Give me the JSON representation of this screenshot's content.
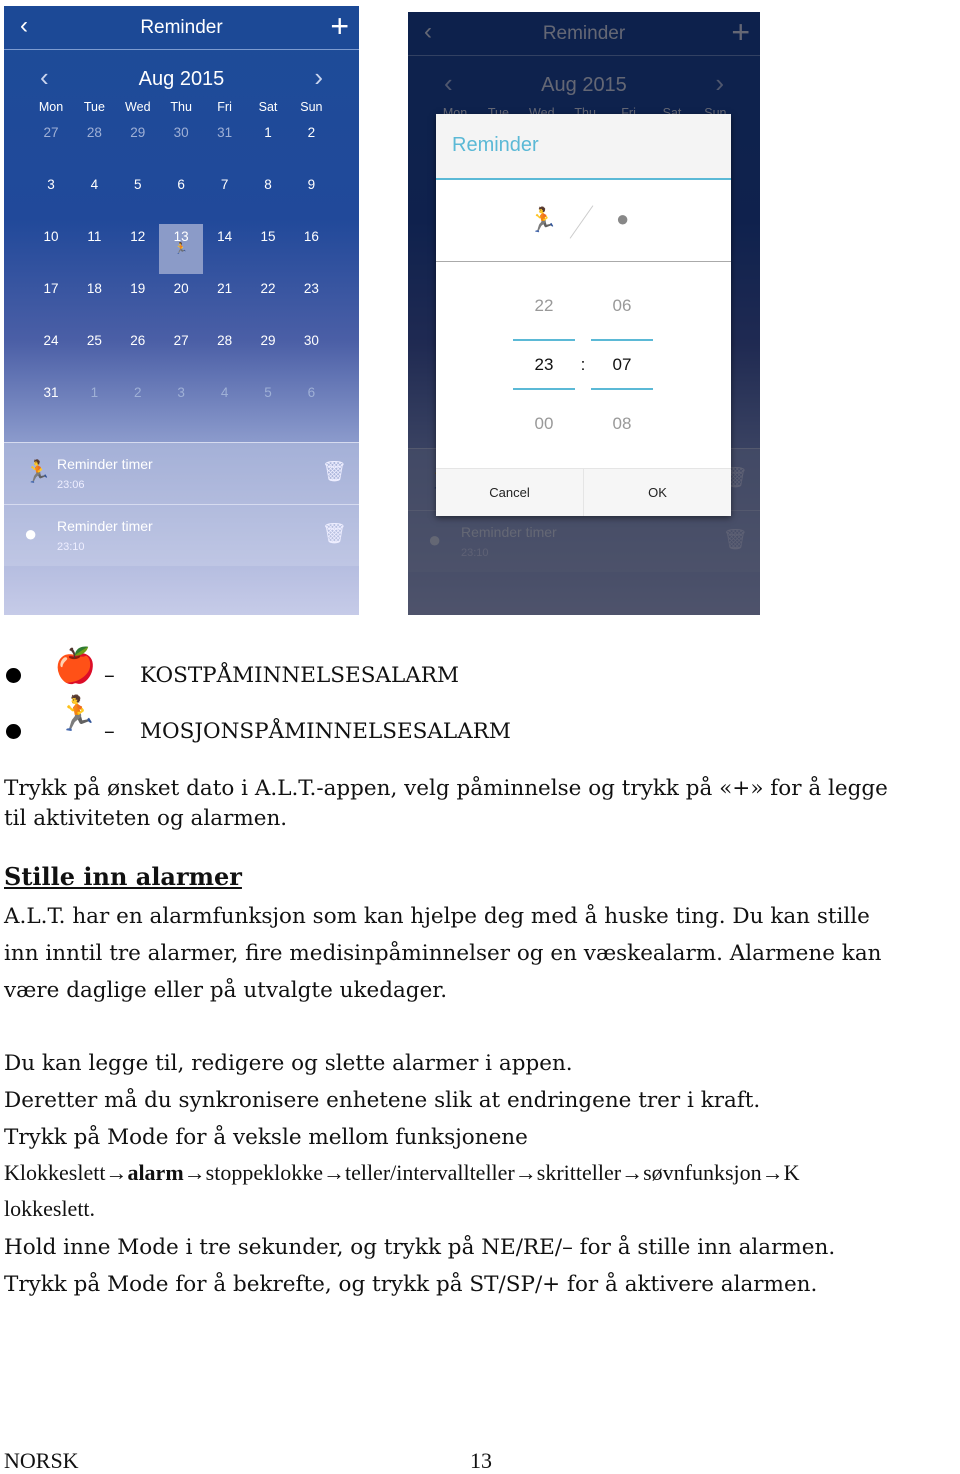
{
  "app": {
    "title": "Reminder",
    "month": "Aug 2015",
    "weekdays": [
      "Mon",
      "Tue",
      "Wed",
      "Thu",
      "Fri",
      "Sat",
      "Sun"
    ],
    "weeks": [
      [
        "27",
        "28",
        "29",
        "30",
        "31",
        "1",
        "2"
      ],
      [
        "3",
        "4",
        "5",
        "6",
        "7",
        "8",
        "9"
      ],
      [
        "10",
        "11",
        "12",
        "13",
        "14",
        "15",
        "16"
      ],
      [
        "17",
        "18",
        "19",
        "20",
        "21",
        "22",
        "23"
      ],
      [
        "24",
        "25",
        "26",
        "27",
        "28",
        "29",
        "30"
      ],
      [
        "31",
        "1",
        "2",
        "3",
        "4",
        "5",
        "6"
      ]
    ],
    "selected_day": "13",
    "reminders": [
      {
        "label": "Reminder timer",
        "time": "23:06",
        "icon": "runner-icon"
      },
      {
        "label": "Reminder timer",
        "time": "23:10",
        "icon": "apple-icon"
      }
    ]
  },
  "dialog": {
    "title": "Reminder",
    "hours": [
      "22",
      "23",
      "00"
    ],
    "minutes": [
      "06",
      "07",
      "08"
    ],
    "separator": ":",
    "cancel": "Cancel",
    "ok": "OK"
  },
  "doc": {
    "legend": [
      {
        "icon": "apple-icon",
        "dash": "–",
        "text": "KOSTPÅMINNELSESALARM"
      },
      {
        "icon": "runner-icon",
        "dash": "–",
        "text": "MOSJONSPÅMINNELSESALARM"
      }
    ],
    "p1": [
      "Trykk på ønsket dato i A.L.T.-appen, velg påminnelse og trykk på «+» for å legge",
      "til aktiviteten og alarmen."
    ],
    "heading": "Stille inn alarmer",
    "p2": [
      "A.L.T. har en alarmfunksjon som kan hjelpe deg med å huske ting. Du kan stille",
      "inn inntil tre alarmer, fire medisinpåminnelser og en væskealarm. Alarmene kan",
      "være daglige eller på utvalgte ukedager."
    ],
    "p3": [
      "Du kan legge til, redigere og slette alarmer i appen.",
      "Deretter må du synkronisere enhetene slik at endringene trer i kraft.",
      "Trykk på Mode for å veksle mellom funksjonene"
    ],
    "seq_a": "Klokkeslett→",
    "seq_b": "alarm",
    "seq_c": "→stoppeklokke→teller/intervallteller→skritteller→søvnfunksjon→K",
    "seq_d": "lokkeslett.",
    "p4": [
      "Hold inne Mode i tre sekunder, og trykk på NE/RE/– for å stille inn alarmen.",
      "Trykk på Mode for å bekrefte, og trykk på ST/SP/+ for å aktivere alarmen."
    ],
    "footer_left": "NORSK",
    "footer_page": "13"
  }
}
